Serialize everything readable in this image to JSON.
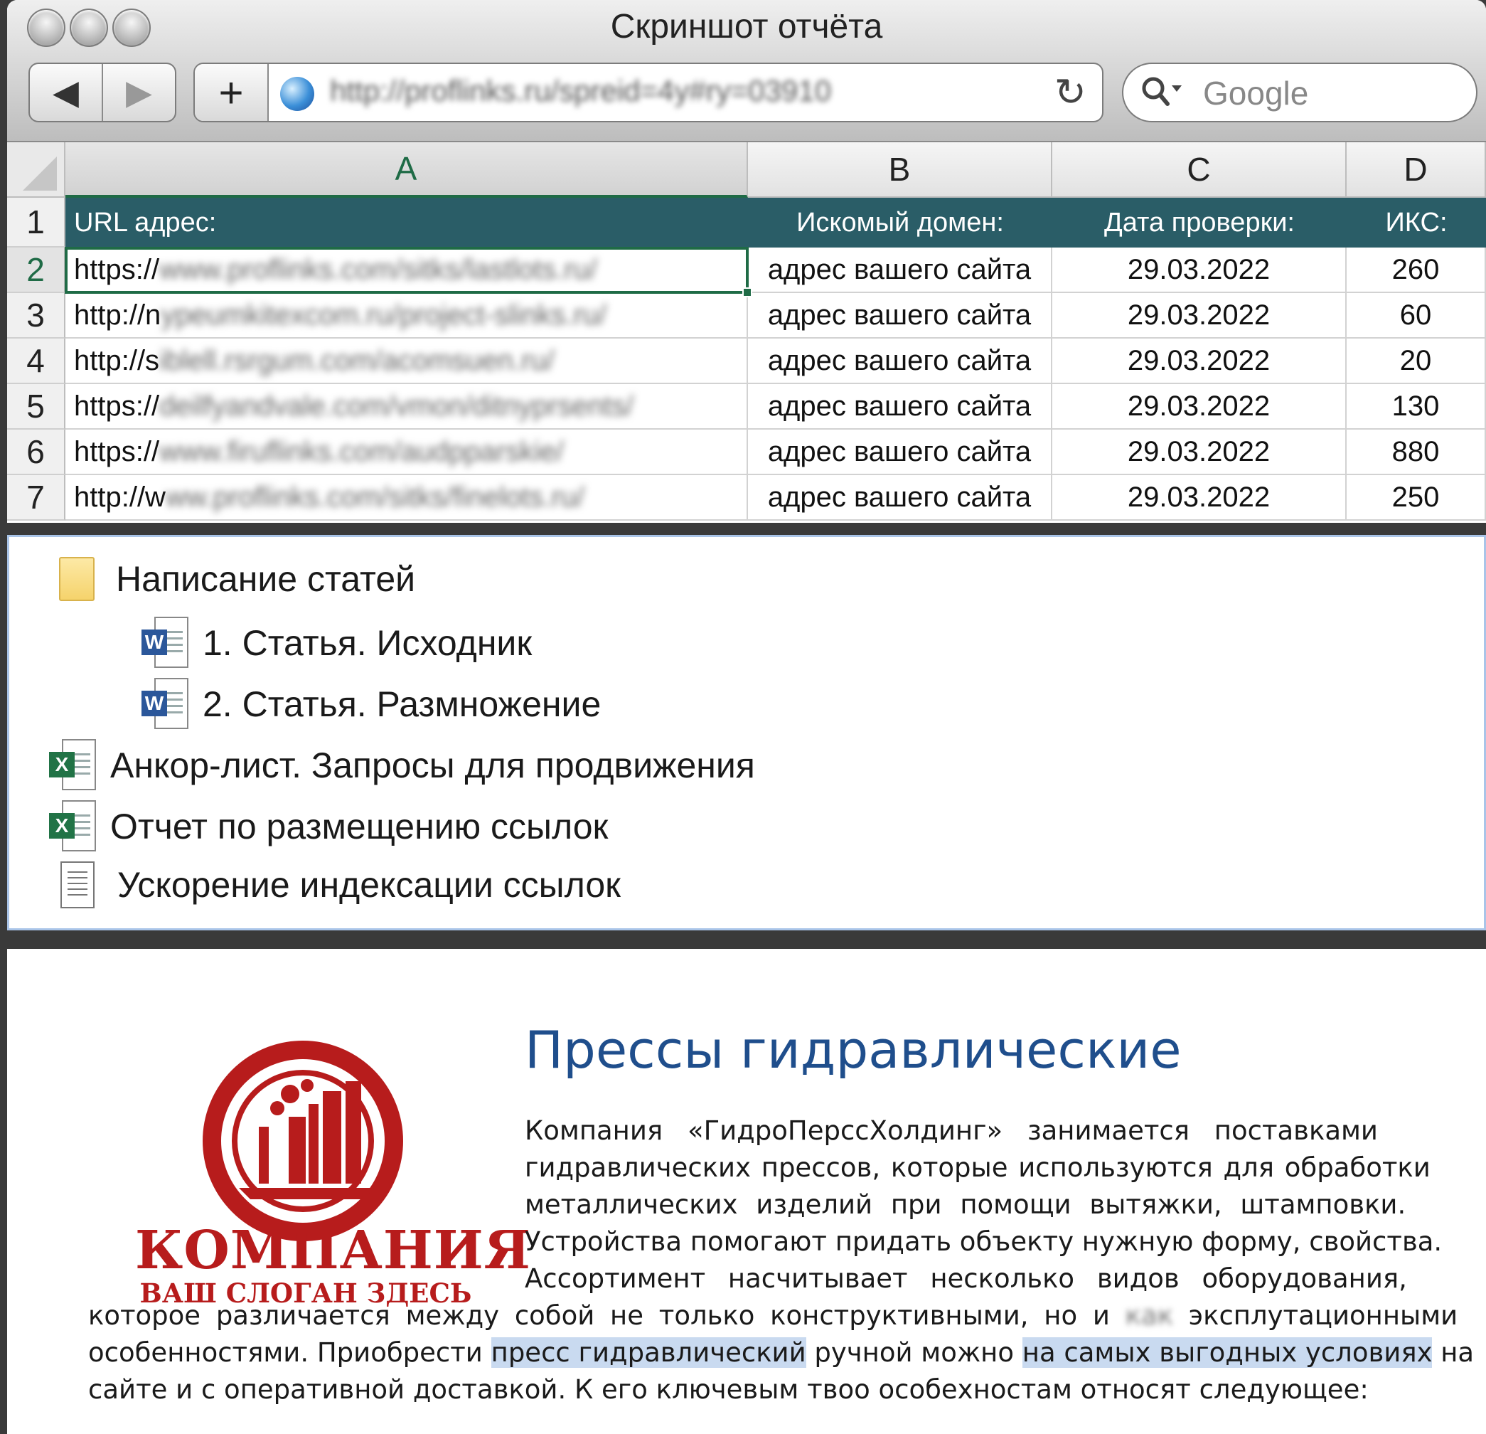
{
  "window": {
    "title": "Скриншот отчёта"
  },
  "toolbar": {
    "back_icon": "◀",
    "forward_icon": "▶",
    "new_tab_icon": "+",
    "url": "http://proflinks.ru/spreid=4y#ry=03910",
    "reload_icon": "↻",
    "search_icon": "🔍▾",
    "search_placeholder": "Google"
  },
  "sheet": {
    "columns": [
      "A",
      "B",
      "C",
      "D"
    ],
    "row_numbers": [
      "1",
      "2",
      "3",
      "4",
      "5",
      "6",
      "7"
    ],
    "header": {
      "url": "URL адрес:",
      "domain": "Искомый домен:",
      "date": "Дата проверки:",
      "iks": "ИКС:"
    },
    "rows": [
      {
        "url_prefix": "https://",
        "url_rest": "www.proflinks.com/sitks/lastlots.ru/",
        "domain": "адрес вашего сайта",
        "date": "29.03.2022",
        "iks": "260"
      },
      {
        "url_prefix": "http://n",
        "url_rest": "ypeumkitexcom.ru/project-slinks.ru/",
        "domain": "адрес вашего сайта",
        "date": "29.03.2022",
        "iks": "60"
      },
      {
        "url_prefix": "http://s",
        "url_rest": "iblell.rsrgum.com/acomsuen.ru/",
        "domain": "адрес вашего сайта",
        "date": "29.03.2022",
        "iks": "20"
      },
      {
        "url_prefix": "https://",
        "url_rest": "deilfyandvale.com/vmon/ditnyprsents/",
        "domain": "адрес вашего сайта",
        "date": "29.03.2022",
        "iks": "130"
      },
      {
        "url_prefix": "https://",
        "url_rest": "www.firuflinks.com/audpparskie/",
        "domain": "адрес вашего сайта",
        "date": "29.03.2022",
        "iks": "880"
      },
      {
        "url_prefix": "http://w",
        "url_rest": "ww.proflinks.com/sitks/finelots.ru/",
        "domain": "адрес вашего сайта",
        "date": "29.03.2022",
        "iks": "250"
      }
    ]
  },
  "files": {
    "folder": {
      "label": "Написание статей",
      "icon": "folder-icon"
    },
    "items": [
      {
        "label": "1. Статья. Исходник",
        "icon": "word-document-icon"
      },
      {
        "label": "2. Статья. Размножение",
        "icon": "word-document-icon"
      },
      {
        "label": "Анкор-лист. Запросы для продвижения",
        "icon": "excel-document-icon"
      },
      {
        "label": "Отчет по размещению ссылок",
        "icon": "excel-document-icon"
      },
      {
        "label": "Ускорение индексации ссылок",
        "icon": "text-document-icon"
      }
    ],
    "word_badge": "W",
    "excel_badge": "X"
  },
  "document": {
    "title": "Прессы гидравлические",
    "logo": {
      "main": "КОМПАНИЯ",
      "slogan": "ВАШ СЛОГАН ЗДЕСЬ",
      "color": "#b71c1c"
    },
    "para_lines": [
      [
        "Компания",
        "«ГидроПерссХолдинг»",
        "занимается",
        "поставками"
      ],
      "гидравлических прессов, которые используются для обработки",
      "металлических изделий при помощи вытяжки, штамповки.",
      "Устройства помогают придать объекту нужную форму, свойства.",
      "Ассортимент насчитывает несколько видов оборудования,"
    ],
    "line6_a": "которое различается между собой не только конструктивными, но и ",
    "line6_blur": "как",
    "line6_b": " эксплутационными",
    "line7_a": "особенностями. Приобрести ",
    "line7_hl1": "пресс гидравлический",
    "line7_b": " ручной можно ",
    "line7_hl2": "на самых выгодных условиях",
    "line7_c": " на",
    "line8": "сайте и с оперативной доставкой. К его ключевым твоо особехностам относят следующее:",
    "title_color": "#1f4e8c",
    "highlight_color": "#c9daf0"
  }
}
